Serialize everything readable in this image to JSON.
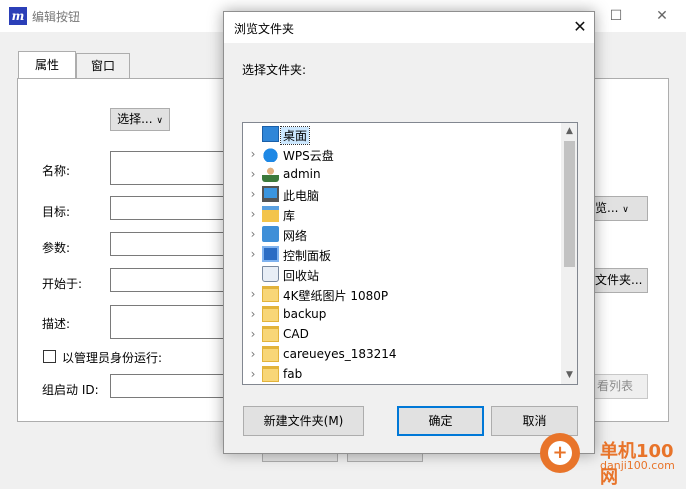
{
  "background_window": {
    "title": "编辑按钮",
    "tabs": [
      "属性",
      "窗口"
    ],
    "select_button": "选择...",
    "labels": {
      "name": "名称:",
      "target": "目标:",
      "args": "参数:",
      "start_in": "开始于:",
      "description": "描述:",
      "run_as_admin": "以管理员身份运行:",
      "group_id": "组启动 ID:"
    },
    "partial_buttons": {
      "dropdown": "览...",
      "browse_folder": "文件夹...",
      "view_list": "看列表"
    }
  },
  "dialog": {
    "title": "浏览文件夹",
    "close_glyph": "✕",
    "prompt": "选择文件夹:",
    "tree": [
      {
        "label": "桌面",
        "icon": "desktop-icon",
        "expandable": false,
        "selected": true
      },
      {
        "label": "WPS云盘",
        "icon": "cloud-icon",
        "expandable": true
      },
      {
        "label": "admin",
        "icon": "user-icon",
        "expandable": true
      },
      {
        "label": "此电脑",
        "icon": "computer-icon",
        "expandable": true
      },
      {
        "label": "库",
        "icon": "library-icon",
        "expandable": true
      },
      {
        "label": "网络",
        "icon": "network-icon",
        "expandable": true
      },
      {
        "label": "控制面板",
        "icon": "control-panel-icon",
        "expandable": true
      },
      {
        "label": "回收站",
        "icon": "recycle-bin-icon",
        "expandable": false
      },
      {
        "label": "4K壁纸图片 1080P",
        "icon": "folder-icon",
        "expandable": true
      },
      {
        "label": "backup",
        "icon": "printer-folder-icon",
        "expandable": true
      },
      {
        "label": "CAD",
        "icon": "folder-icon",
        "expandable": true
      },
      {
        "label": "careueyes_183214",
        "icon": "folder-icon",
        "expandable": true
      },
      {
        "label": "fab",
        "icon": "folder-icon",
        "expandable": true
      }
    ],
    "buttons": {
      "new_folder": "新建文件夹(M)",
      "ok": "确定",
      "cancel": "取消"
    }
  },
  "watermark": {
    "title": "单机100网",
    "url": "danji100.com"
  },
  "colors": {
    "selection": "#cce8ff",
    "primary_border": "#0078d7",
    "watermark": "#e8742a"
  }
}
